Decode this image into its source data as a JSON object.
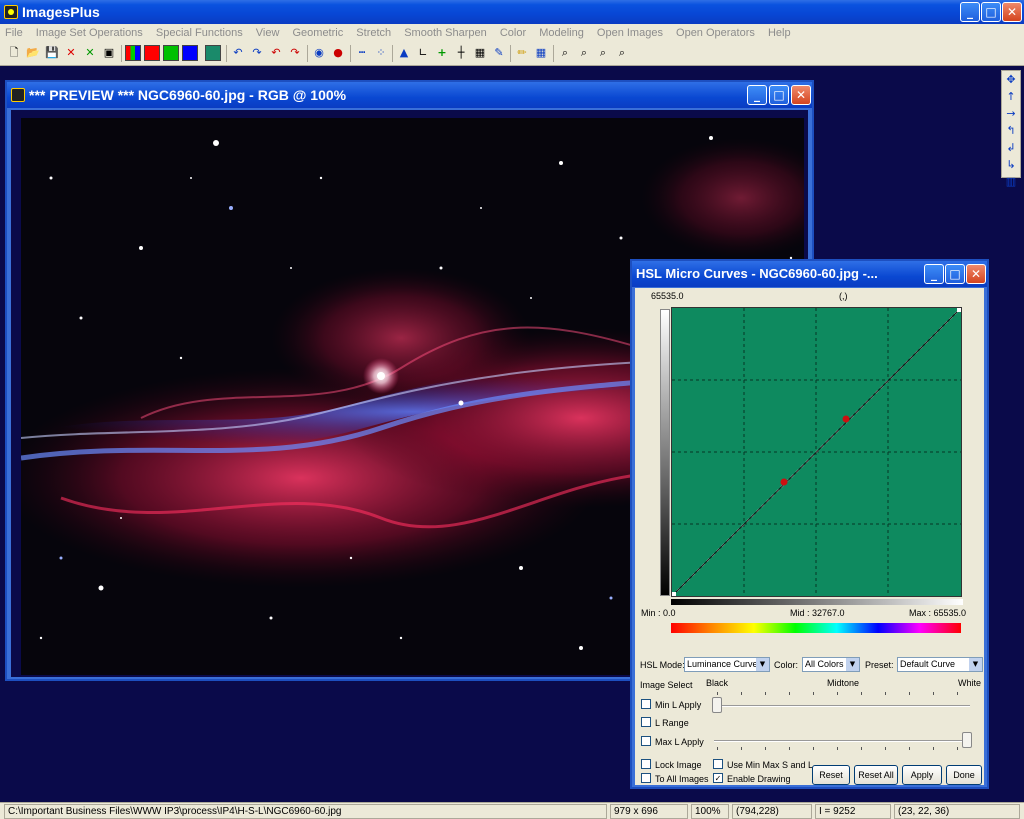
{
  "app": {
    "title": "ImagesPlus"
  },
  "window_controls": {
    "minimize": "_",
    "maximize": "□",
    "close": "✕"
  },
  "menu": [
    "File",
    "Image Set Operations",
    "Special Functions",
    "View",
    "Geometric",
    "Stretch",
    "Smooth Sharpen",
    "Color",
    "Modeling",
    "Open Images",
    "Open Operators",
    "Help"
  ],
  "toolbar": {
    "icons": [
      "new-file",
      "open-file",
      "save",
      "close-red",
      "close-green",
      "print",
      "rgb-channels",
      "red-channel",
      "green-channel",
      "blue-channel",
      "grid",
      "undo",
      "redo",
      "undo-all",
      "redo-all",
      "circle-outline",
      "circle-filled",
      "dotted-line",
      "scatter",
      "histogram",
      "levels",
      "add",
      "crosshair",
      "image-info",
      "brush",
      "pencil",
      "grid-view",
      "zoom",
      "zoom-in",
      "zoom-out",
      "zoom-fit"
    ],
    "colors": {
      "red": "#ff0000",
      "green": "#00c000",
      "blue": "#0000ff"
    }
  },
  "vtoolbar": {
    "icons": [
      "move-icon",
      "arrow-up-icon",
      "arrow-right-icon",
      "rotate-left-icon",
      "rotate-back-icon",
      "rotate-right-icon",
      "fit-icon"
    ]
  },
  "preview": {
    "title": "*** PREVIEW *** NGC6960-60.jpg - RGB @  100%"
  },
  "hsl_dialog": {
    "title": "HSL Micro Curves - NGC6960-60.jpg -...",
    "top_value": "65535.0",
    "cursor_readout": "(,)",
    "min_label": "Min : 0.0",
    "mid_label": "Mid : 32767.0",
    "max_label": "Max : 65535.0",
    "mode_label": "HSL Mode:",
    "mode_value": "Luminance Curve",
    "color_label": "Color:",
    "color_value": "All Colors",
    "preset_label": "Preset:",
    "preset_value": "Default Curve",
    "image_select": "Image Select",
    "slider_black": "Black",
    "slider_midtone": "Midtone",
    "slider_white": "White",
    "checks": {
      "min_l_apply": {
        "label": "Min L Apply",
        "checked": false
      },
      "l_range": {
        "label": "L Range",
        "checked": false
      },
      "max_l_apply": {
        "label": "Max L Apply",
        "checked": false
      },
      "lock_image": {
        "label": "Lock Image",
        "checked": false
      },
      "to_all_images": {
        "label": "To All Images",
        "checked": false
      },
      "use_min_max": {
        "label": "Use Min Max S and L",
        "checked": false
      },
      "enable_drawing": {
        "label": "Enable Drawing",
        "checked": true
      }
    },
    "buttons": {
      "reset": "Reset",
      "reset_all": "Reset All",
      "apply": "Apply",
      "done": "Done"
    },
    "colors": {
      "curve_bg": "#0e8a5f",
      "control_point": "#cc1111"
    }
  },
  "status": {
    "path": "C:\\Important Business Files\\WWW IP3\\process\\IP4\\H-S-L\\NGC6960-60.jpg",
    "dimensions": "979 x 696",
    "zoom": "100%",
    "coords": "(794,228)",
    "intensity": "I = 9252",
    "rgb": "(23, 22, 36)"
  }
}
